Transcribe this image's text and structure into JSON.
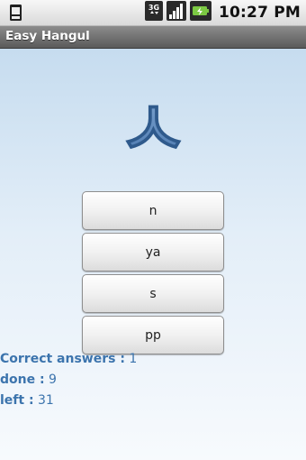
{
  "status_bar": {
    "time": "10:27 PM",
    "network_type": "3G",
    "icons": [
      "notification-icon",
      "3g-data-icon",
      "signal-strength-icon",
      "battery-charging-icon"
    ]
  },
  "app": {
    "title": "Easy Hangul"
  },
  "quiz": {
    "character": "ㅅ",
    "options": [
      "n",
      "ya",
      "s",
      "pp"
    ]
  },
  "stats": {
    "correct_label": "Correct answers :",
    "correct_value": "1",
    "done_label": "done :",
    "done_value": "9",
    "left_label": "left :",
    "left_value": "31"
  },
  "colors": {
    "accent": "#3c74ad",
    "glyph": "#5a86ba",
    "background_top": "#c6dcef",
    "background_bottom": "#f7fafd"
  }
}
